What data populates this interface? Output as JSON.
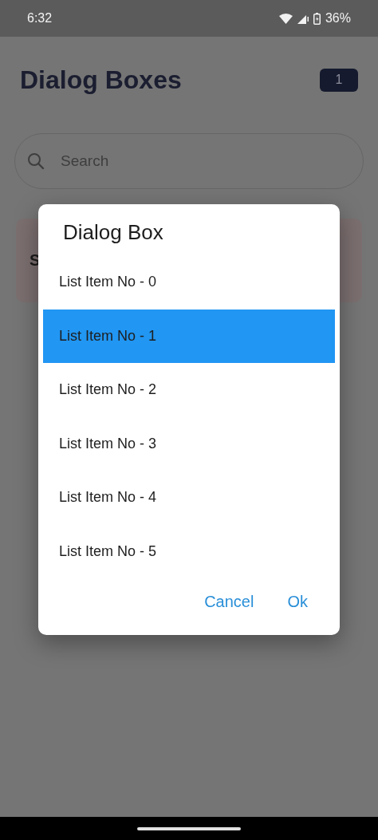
{
  "status_bar": {
    "time": "6:32",
    "battery": "36%"
  },
  "header": {
    "title": "Dialog Boxes",
    "badge": "1"
  },
  "search": {
    "placeholder": "Search"
  },
  "card": {
    "title": "S"
  },
  "dialog": {
    "title": "Dialog Box",
    "items": [
      {
        "label": "List Item No - 0",
        "selected": false
      },
      {
        "label": "List Item No - 1",
        "selected": true
      },
      {
        "label": "List Item No - 2",
        "selected": false
      },
      {
        "label": "List Item No - 3",
        "selected": false
      },
      {
        "label": "List Item No - 4",
        "selected": false
      },
      {
        "label": "List Item No - 5",
        "selected": false
      }
    ],
    "buttons": [
      "Cancel",
      "Ok"
    ]
  }
}
